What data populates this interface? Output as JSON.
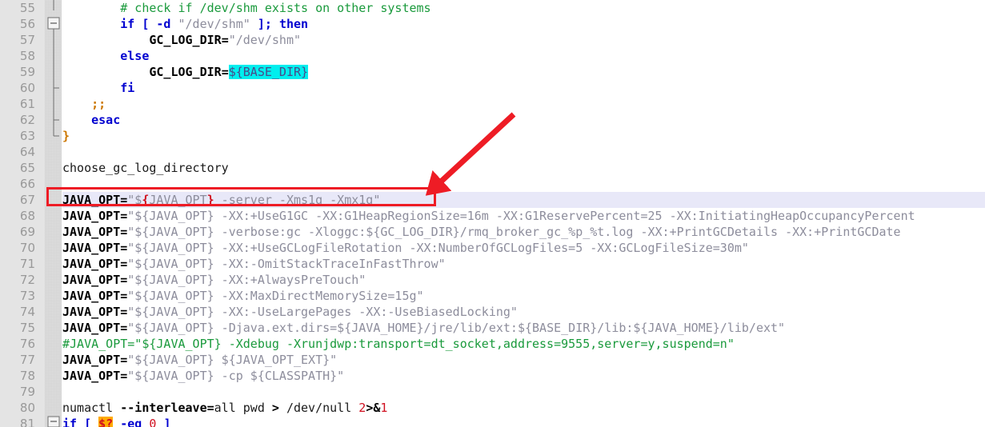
{
  "editor": {
    "name": "code-editor",
    "language": "shell",
    "first_visible_line": 55,
    "last_visible_line": 81,
    "line_numbers": [
      55,
      56,
      57,
      58,
      59,
      60,
      61,
      62,
      63,
      64,
      65,
      66,
      67,
      68,
      69,
      70,
      71,
      72,
      73,
      74,
      75,
      76,
      77,
      78,
      79,
      80,
      81
    ],
    "current_line": 67,
    "colors": {
      "background": "#ffffff",
      "gutter_background": "#e4e4e4",
      "line_number": "#999999",
      "comment": "#1a9a3c",
      "keyword": "#0000d0",
      "string": "#8d8d9c",
      "brace": "#cc7700",
      "number": "#d01020",
      "current_line_band": "#e8e8f8",
      "search_highlight": "#00eeee",
      "variable_highlight": "#ffaa00",
      "annotation_red": "#ee1c25"
    }
  },
  "annotations": {
    "red_box": {
      "label": "highlight-box-line-67",
      "target_line": 67,
      "color": "#ee1c25"
    },
    "red_arrow": {
      "label": "pointer-arrow-to-line-67",
      "color": "#ee1c25",
      "points_to": "line 67 JAVA_OPT server Xms1g Xmx1g"
    }
  },
  "lines": [
    {
      "n": 55,
      "tokens": [
        {
          "t": "plain",
          "s": "        "
        },
        {
          "t": "comment",
          "s": "# check if /dev/shm exists on other systems"
        }
      ]
    },
    {
      "n": 56,
      "tokens": [
        {
          "t": "plain",
          "s": "        "
        },
        {
          "t": "kw",
          "s": "if"
        },
        {
          "t": "plain",
          "s": " "
        },
        {
          "t": "kw",
          "s": "["
        },
        {
          "t": "plain",
          "s": " "
        },
        {
          "t": "kw",
          "s": "-d"
        },
        {
          "t": "plain",
          "s": " "
        },
        {
          "t": "str",
          "s": "\"/dev/shm\""
        },
        {
          "t": "plain",
          "s": " "
        },
        {
          "t": "kw",
          "s": "]"
        },
        {
          "t": "kw",
          "s": ";"
        },
        {
          "t": "plain",
          "s": " "
        },
        {
          "t": "kw",
          "s": "then"
        }
      ]
    },
    {
      "n": 57,
      "tokens": [
        {
          "t": "plain",
          "s": "            "
        },
        {
          "t": "name",
          "s": "GC_LOG_DIR"
        },
        {
          "t": "op",
          "s": "="
        },
        {
          "t": "str",
          "s": "\"/dev/shm\""
        }
      ]
    },
    {
      "n": 58,
      "tokens": [
        {
          "t": "plain",
          "s": "        "
        },
        {
          "t": "kw",
          "s": "else"
        }
      ]
    },
    {
      "n": 59,
      "tokens": [
        {
          "t": "plain",
          "s": "            "
        },
        {
          "t": "name",
          "s": "GC_LOG_DIR"
        },
        {
          "t": "op",
          "s": "="
        },
        {
          "t": "hl-cyan",
          "s": "${BASE_DIR}"
        }
      ]
    },
    {
      "n": 60,
      "tokens": [
        {
          "t": "plain",
          "s": "        "
        },
        {
          "t": "kw",
          "s": "fi"
        }
      ]
    },
    {
      "n": 61,
      "tokens": [
        {
          "t": "plain",
          "s": "    "
        },
        {
          "t": "brace",
          "s": ";;"
        }
      ]
    },
    {
      "n": 62,
      "tokens": [
        {
          "t": "plain",
          "s": "    "
        },
        {
          "t": "kw",
          "s": "esac"
        }
      ]
    },
    {
      "n": 63,
      "tokens": [
        {
          "t": "brace",
          "s": "}"
        }
      ]
    },
    {
      "n": 64,
      "tokens": []
    },
    {
      "n": 65,
      "tokens": [
        {
          "t": "plain",
          "s": "choose_gc_log_directory"
        }
      ]
    },
    {
      "n": 66,
      "tokens": []
    },
    {
      "n": 67,
      "current": true,
      "tokens": [
        {
          "t": "name",
          "s": "JAVA_OPT"
        },
        {
          "t": "op",
          "s": "="
        },
        {
          "t": "str",
          "s": "\"$"
        },
        {
          "t": "red",
          "s": "{"
        },
        {
          "t": "var",
          "s": "JAVA_OPT"
        },
        {
          "t": "red",
          "s": "}"
        },
        {
          "t": "str",
          "s": " -server -Xms1g -Xmx1g\""
        }
      ]
    },
    {
      "n": 68,
      "tokens": [
        {
          "t": "name",
          "s": "JAVA_OPT"
        },
        {
          "t": "op",
          "s": "="
        },
        {
          "t": "str",
          "s": "\"${JAVA_OPT} -XX:+UseG1GC -XX:G1HeapRegionSize=16m -XX:G1ReservePercent=25 -XX:InitiatingHeapOccupancyPercent"
        }
      ]
    },
    {
      "n": 69,
      "tokens": [
        {
          "t": "name",
          "s": "JAVA_OPT"
        },
        {
          "t": "op",
          "s": "="
        },
        {
          "t": "str",
          "s": "\"${JAVA_OPT} -verbose:gc -Xloggc:${GC_LOG_DIR}/rmq_broker_gc_%p_%t.log -XX:+PrintGCDetails -XX:+PrintGCDate"
        }
      ]
    },
    {
      "n": 70,
      "tokens": [
        {
          "t": "name",
          "s": "JAVA_OPT"
        },
        {
          "t": "op",
          "s": "="
        },
        {
          "t": "str",
          "s": "\"${JAVA_OPT} -XX:+UseGCLogFileRotation -XX:NumberOfGCLogFiles=5 -XX:GCLogFileSize=30m\""
        }
      ]
    },
    {
      "n": 71,
      "tokens": [
        {
          "t": "name",
          "s": "JAVA_OPT"
        },
        {
          "t": "op",
          "s": "="
        },
        {
          "t": "str",
          "s": "\"${JAVA_OPT} -XX:-OmitStackTraceInFastThrow\""
        }
      ]
    },
    {
      "n": 72,
      "tokens": [
        {
          "t": "name",
          "s": "JAVA_OPT"
        },
        {
          "t": "op",
          "s": "="
        },
        {
          "t": "str",
          "s": "\"${JAVA_OPT} -XX:+AlwaysPreTouch\""
        }
      ]
    },
    {
      "n": 73,
      "tokens": [
        {
          "t": "name",
          "s": "JAVA_OPT"
        },
        {
          "t": "op",
          "s": "="
        },
        {
          "t": "str",
          "s": "\"${JAVA_OPT} -XX:MaxDirectMemorySize=15g\""
        }
      ]
    },
    {
      "n": 74,
      "tokens": [
        {
          "t": "name",
          "s": "JAVA_OPT"
        },
        {
          "t": "op",
          "s": "="
        },
        {
          "t": "str",
          "s": "\"${JAVA_OPT} -XX:-UseLargePages -XX:-UseBiasedLocking\""
        }
      ]
    },
    {
      "n": 75,
      "tokens": [
        {
          "t": "name",
          "s": "JAVA_OPT"
        },
        {
          "t": "op",
          "s": "="
        },
        {
          "t": "str",
          "s": "\"${JAVA_OPT} -Djava.ext.dirs=${JAVA_HOME}/jre/lib/ext:${BASE_DIR}/lib:${JAVA_HOME}/lib/ext\""
        }
      ]
    },
    {
      "n": 76,
      "tokens": [
        {
          "t": "comment",
          "s": "#JAVA_OPT=\"${JAVA_OPT} -Xdebug -Xrunjdwp:transport=dt_socket,address=9555,server=y,suspend=n\""
        }
      ]
    },
    {
      "n": 77,
      "tokens": [
        {
          "t": "name",
          "s": "JAVA_OPT"
        },
        {
          "t": "op",
          "s": "="
        },
        {
          "t": "str",
          "s": "\"${JAVA_OPT} ${JAVA_OPT_EXT}\""
        }
      ]
    },
    {
      "n": 78,
      "tokens": [
        {
          "t": "name",
          "s": "JAVA_OPT"
        },
        {
          "t": "op",
          "s": "="
        },
        {
          "t": "str",
          "s": "\"${JAVA_OPT} -cp ${CLASSPATH}\""
        }
      ]
    },
    {
      "n": 79,
      "tokens": []
    },
    {
      "n": 80,
      "tokens": [
        {
          "t": "plain",
          "s": "numactl "
        },
        {
          "t": "op",
          "s": "--interleave="
        },
        {
          "t": "plain",
          "s": "all pwd "
        },
        {
          "t": "op",
          "s": ">"
        },
        {
          "t": "plain",
          "s": " /dev/null "
        },
        {
          "t": "num",
          "s": "2"
        },
        {
          "t": "op",
          "s": ">&"
        },
        {
          "t": "num",
          "s": "1"
        }
      ]
    },
    {
      "n": 81,
      "tokens": [
        {
          "t": "kw",
          "s": "if"
        },
        {
          "t": "plain",
          "s": " "
        },
        {
          "t": "kw",
          "s": "["
        },
        {
          "t": "plain",
          "s": " "
        },
        {
          "t": "hl-orange",
          "s": "$?"
        },
        {
          "t": "plain",
          "s": " "
        },
        {
          "t": "kw",
          "s": "-eq"
        },
        {
          "t": "plain",
          "s": " "
        },
        {
          "t": "num",
          "s": "0"
        },
        {
          "t": "plain",
          "s": " "
        },
        {
          "t": "kw",
          "s": "]"
        }
      ]
    }
  ],
  "fold_markers": [
    {
      "line": 56,
      "type": "collapse-box"
    },
    {
      "line": 60,
      "type": "branch"
    },
    {
      "line": 62,
      "type": "branch"
    },
    {
      "line": 63,
      "type": "end"
    },
    {
      "line": 81,
      "type": "collapse-box"
    }
  ]
}
